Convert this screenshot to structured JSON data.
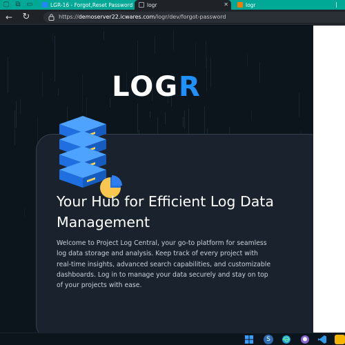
{
  "browser": {
    "tabs": [
      {
        "title": "LGR-16 - Forgot,Reset Password - Jira",
        "active": false,
        "favicon_color": "#2684ff"
      },
      {
        "title": "logr",
        "active": true,
        "favicon_color": "#9aa0a6"
      },
      {
        "title": "logr",
        "active": false,
        "favicon_color": "#f57c00"
      }
    ],
    "url_prefix": "https://",
    "url_host": "demoserver22.icwares.com",
    "url_path": "/logr/dev/forgot-password"
  },
  "logo": {
    "main": "LOG",
    "accent": "R"
  },
  "hero": {
    "headline": "Your Hub for Efficient Log Data Management",
    "description": "Welcome to Project Log Central, your go-to platform for seamless log data storage and analysis. Keep track of every project with real-time insights, advanced search capabilities, and customizable dashboards. Log in to manage your data securely and stay on top of your projects with ease."
  },
  "taskbar": {
    "icons": [
      "windows-icon",
      "search-icon",
      "task-view-icon",
      "file-explorer-icon",
      "skype-icon",
      "edge-icon",
      "github-icon",
      "vscode-icon",
      "app-icon"
    ]
  },
  "colors": {
    "accent": "#1e90ff",
    "tabbar": "#00a896",
    "page_bg": "#0c141c",
    "card_bg": "#1a232d"
  }
}
